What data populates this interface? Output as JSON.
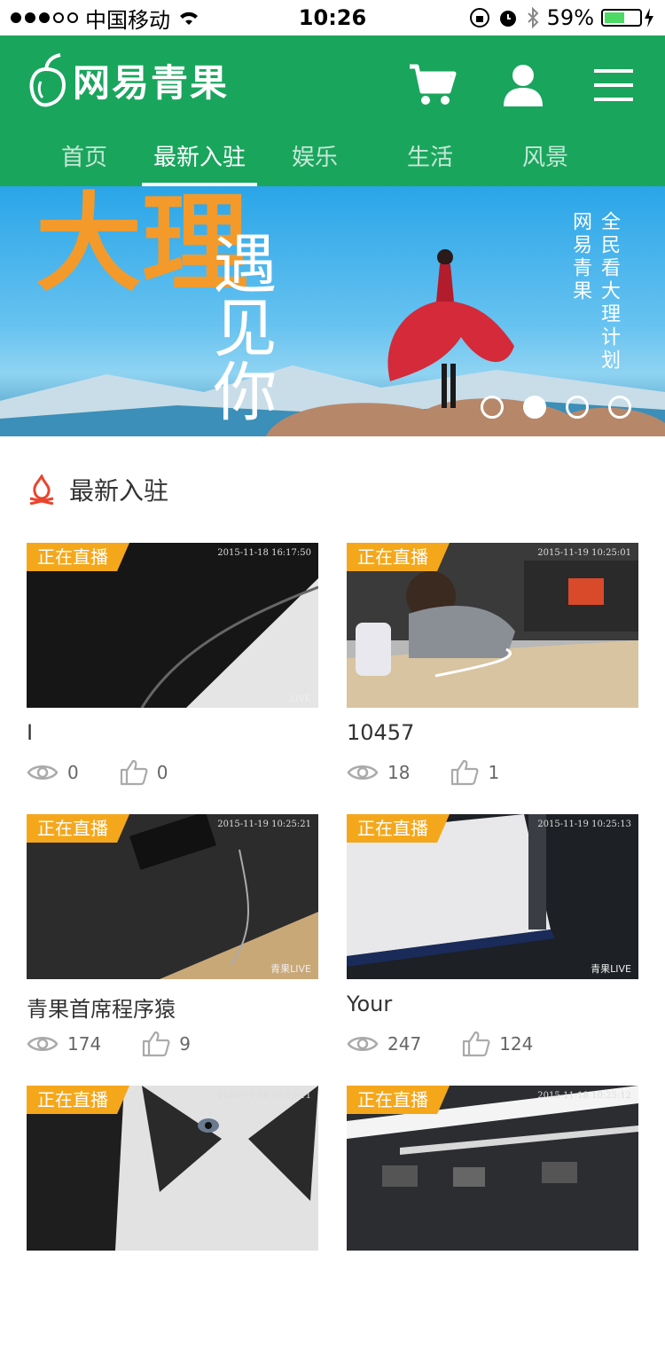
{
  "status_bar": {
    "carrier": "中国移动",
    "time": "10:26",
    "battery": "59%"
  },
  "header": {
    "brand": "网易青果",
    "icons": [
      "cart-icon",
      "user-icon",
      "menu-icon"
    ],
    "tabs": [
      {
        "label": "首页",
        "active": false
      },
      {
        "label": "最新入驻",
        "active": true
      },
      {
        "label": "娱乐",
        "active": false
      },
      {
        "label": "生活",
        "active": false
      },
      {
        "label": "风景",
        "active": false
      }
    ]
  },
  "banner": {
    "big_text": "大理",
    "cursive_text": "遇见你",
    "vertical_line_1": "网易青果",
    "vertical_line_2": "全民看大理计划",
    "dots": 4,
    "active_dot": 1
  },
  "section": {
    "title": "最新入驻",
    "icon": "campfire-icon"
  },
  "cards": [
    {
      "badge": "正在直播",
      "timestamp": "2015-11-18  16:17:50",
      "watermark": "LIVE",
      "title": "I",
      "views": "0",
      "likes": "0"
    },
    {
      "badge": "正在直播",
      "timestamp": "2015-11-19  10:25:01",
      "watermark": "",
      "title": "10457",
      "views": "18",
      "likes": "1"
    },
    {
      "badge": "正在直播",
      "timestamp": "2015-11-19  10:25:21",
      "watermark": "青果LIVE",
      "title": "青果首席程序猿",
      "views": "174",
      "likes": "9"
    },
    {
      "badge": "正在直播",
      "timestamp": "2015-11-19  10:25:13",
      "watermark": "青果LIVE",
      "title": "Your",
      "views": "247",
      "likes": "124"
    },
    {
      "badge": "正在直播",
      "timestamp": "2015-11-18  16:19:11",
      "watermark": "",
      "title": "",
      "views": "",
      "likes": ""
    },
    {
      "badge": "正在直播",
      "timestamp": "2015-11-18  10:25:12",
      "watermark": "",
      "title": "",
      "views": "",
      "likes": ""
    }
  ],
  "colors": {
    "brand_green": "#1aa55d",
    "live_badge": "#f5a71c",
    "banner_orange": "#f39a2b",
    "section_icon_red": "#e8442e"
  }
}
